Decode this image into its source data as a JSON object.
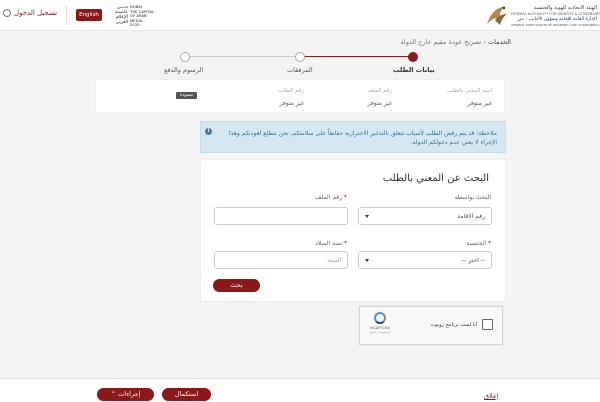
{
  "header": {
    "login_label": "تسجيل الدخول",
    "language_label": "English",
    "dubai_logo": {
      "arabic": "دبـــي عاصمة الإعلام العربي",
      "english_line1": "DUBAI",
      "english_line2": "THE CAPITAL",
      "english_line3": "OF ARAB MEDIA",
      "english_line4": "2020"
    },
    "gdrfa_logo": {
      "arabic_line1": "الهيئة الاتحادية للهوية والجنسية",
      "english_line1": "FEDERAL AUTHORITY FOR IDENTITY & CITIZENSHIP",
      "arabic_line2": "الإدارة العامة للإقامة وشؤون الأجانب - دبي",
      "english_line2": "GENERAL DIRECTORATE OF RESIDENCY AND FOREIGNERS AFFAIRS - DUBAI"
    }
  },
  "breadcrumb": {
    "home": "الخدمات",
    "current": "تصريح عودة مقيم خارج الدولة"
  },
  "steps": [
    {
      "label": "بيانات الطلب",
      "active": true
    },
    {
      "label": "المرفقات",
      "active": false
    },
    {
      "label": "الرسوم والدفع",
      "active": false
    }
  ],
  "summary": {
    "requester_label": "اسم المعني بالطلب",
    "requester_value": "غير متوفر",
    "file_number_label": "رقم الملف",
    "file_number_value": "غير متوفر",
    "request_number_label": "رقم الطلب",
    "request_number_value": "غير متوفر",
    "status_badge": "مسودة"
  },
  "notice": {
    "text": "ملاحظة: قد يتم رفض الطلب لأسباب تتعلق بالتدابير الاحترازية حفاظاً على سلامتكم، نحن نتطلع لعودتكم وهذا الإجراء لا يعني عدم دخولكم الدولة."
  },
  "search": {
    "title": "البحث عن المعني بالطلب",
    "search_by_label": "البحث بواسطة",
    "search_by_value": "رقم الاقامة",
    "file_number_label": "رقم الملف",
    "nationality_label": "الجنسية",
    "nationality_value": "-- اختر --",
    "birth_year_label": "سنة الميلاد",
    "birth_year_placeholder": "السنة",
    "search_button": "بحث"
  },
  "captcha": {
    "text": "أنا لست برنامج روبوت",
    "brand": "reCAPTCHA",
    "links": "الخصوصية - البنود"
  },
  "footer": {
    "actions_button": "إجراءات",
    "continue_button": "استكمال",
    "close_link": "إغلاق"
  },
  "colors": {
    "brand": "#8a1a1a",
    "notice_bg": "#d5e8f2",
    "notice_text": "#2d6f95"
  }
}
